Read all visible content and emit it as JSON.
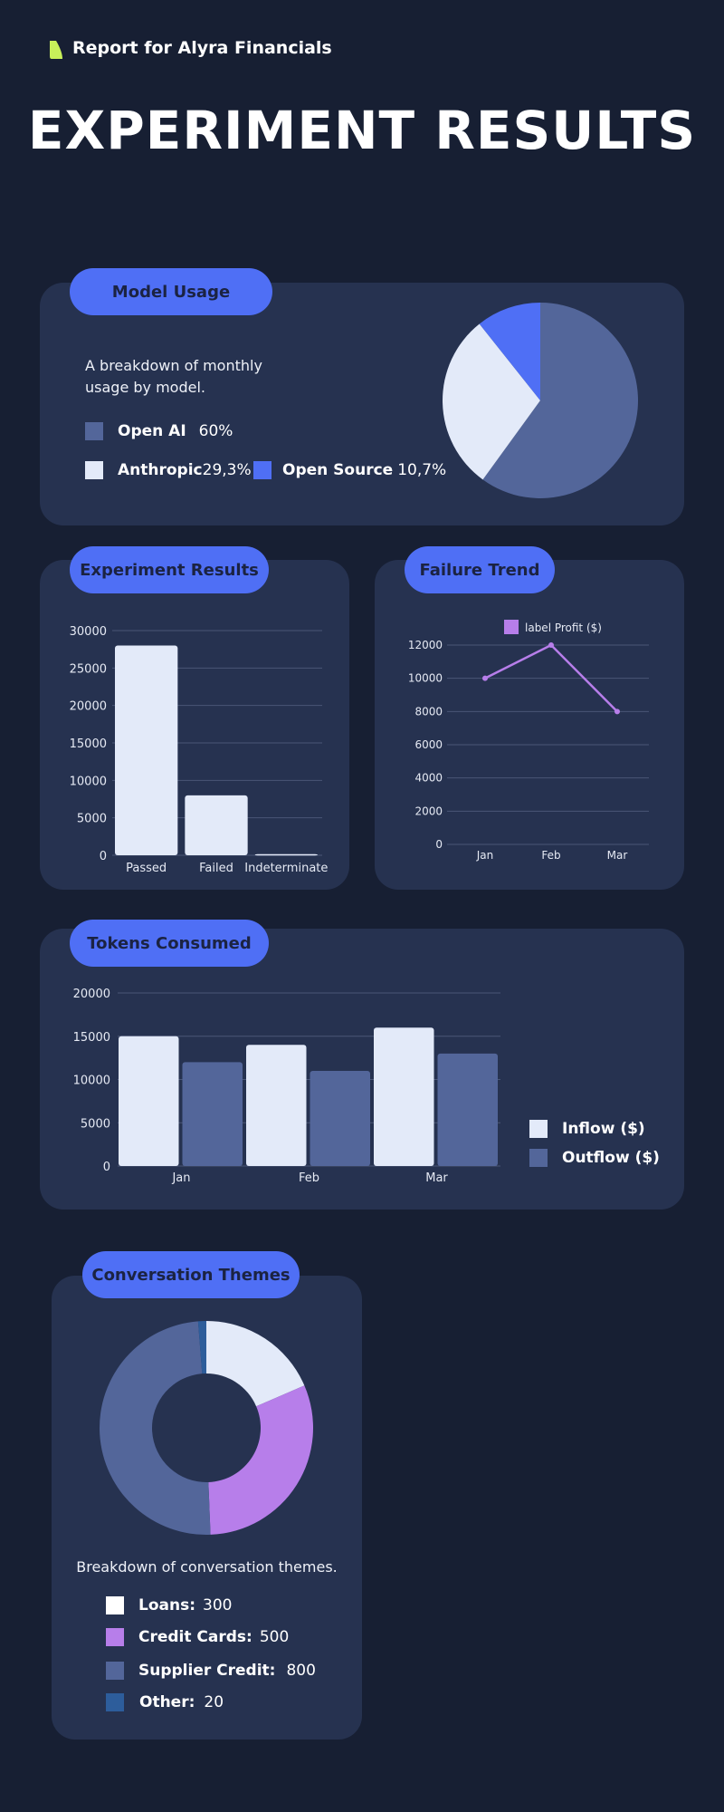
{
  "header": {
    "report_title": "Report for Alyra Financials",
    "main_title": "EXPERIMENT RESULTS"
  },
  "colors": {
    "background": "#171f33",
    "card": "#263250",
    "pill": "#4f6ff5",
    "slate": "#53669a",
    "light": "#e3eaf9",
    "accent_blue": "#4f6ff5",
    "purple": "#b77eea",
    "logo": "#c8f05a"
  },
  "model_usage": {
    "title": "Model Usage",
    "description_line1": "A breakdown of monthly",
    "description_line2": "usage by model.",
    "legend": [
      {
        "name": "Open AI",
        "value": "60%"
      },
      {
        "name": "Anthropic",
        "value": "29,3%"
      },
      {
        "name": "Open Source",
        "value": "10,7%"
      }
    ]
  },
  "experiment_results": {
    "title": "Experiment Results"
  },
  "failure_trend": {
    "title": "Failure Trend"
  },
  "tokens_consumed": {
    "title": "Tokens Consumed",
    "legend": [
      {
        "name": "Inflow ($)"
      },
      {
        "name": "Outflow ($)"
      }
    ]
  },
  "conversation_themes": {
    "title": "Conversation Themes",
    "description": "Breakdown of conversation themes.",
    "legend": [
      {
        "name": "Loans:",
        "value": "300"
      },
      {
        "name": "Credit Cards:",
        "value": "500"
      },
      {
        "name": "Supplier Credit:",
        "value": "800"
      },
      {
        "name": "Other:",
        "value": "20"
      }
    ]
  },
  "chart_data": [
    {
      "id": "model-usage",
      "type": "pie",
      "labels": [
        "Open AI",
        "Anthropic",
        "Open Source"
      ],
      "values": [
        60,
        29.3,
        10.7
      ],
      "colors": [
        "#53669a",
        "#e3eaf9",
        "#4f6ff5"
      ]
    },
    {
      "id": "experiment-results",
      "type": "bar",
      "categories": [
        "Passed",
        "Failed",
        "Indeterminate"
      ],
      "values": [
        28000,
        8000,
        150
      ],
      "ylim": [
        0,
        30000
      ],
      "yticks": [
        "0",
        "5000",
        "10000",
        "15000",
        "20000",
        "25000",
        "30000"
      ],
      "grid": true
    },
    {
      "id": "failure-trend",
      "type": "line",
      "categories": [
        "Jan",
        "Feb",
        "Mar"
      ],
      "series": [
        {
          "name": "label Profit ($)",
          "values": [
            10000,
            12000,
            8000
          ]
        }
      ],
      "ylim": [
        0,
        12000
      ],
      "yticks": [
        "0",
        "2000",
        "4000",
        "6000",
        "8000",
        "10000",
        "12000"
      ],
      "legend_position": "top",
      "grid": true
    },
    {
      "id": "tokens-consumed",
      "type": "bar",
      "categories": [
        "Jan",
        "Feb",
        "Mar"
      ],
      "series": [
        {
          "name": "Inflow ($)",
          "values": [
            15000,
            14000,
            16000
          ]
        },
        {
          "name": "Outflow ($)",
          "values": [
            12000,
            11000,
            13000
          ]
        }
      ],
      "ylim": [
        0,
        20000
      ],
      "yticks": [
        "0",
        "5000",
        "10000",
        "15000",
        "20000"
      ],
      "legend_position": "right",
      "grid": true
    },
    {
      "id": "conversation-themes",
      "type": "pie",
      "subtype": "donut",
      "labels": [
        "Loans",
        "Credit Cards",
        "Supplier Credit",
        "Other"
      ],
      "values": [
        300,
        500,
        800,
        20
      ],
      "colors": [
        "#e3eaf9",
        "#b77eea",
        "#53669a",
        "#2d5d9b"
      ]
    }
  ]
}
